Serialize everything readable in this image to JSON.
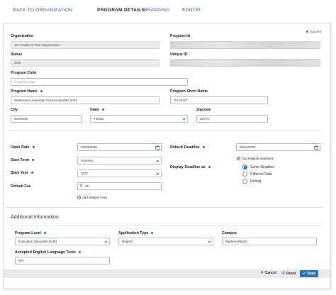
{
  "nav": {
    "back": "BACK TO ORGANIZATION",
    "program_details": "PROGRAM DETAILS",
    "branding": "BRANDING",
    "editor": "EDITOR"
  },
  "required_note": "required",
  "fields": {
    "organization": {
      "label": "Organization",
      "value": "zzz GradCAS Test Organization"
    },
    "program_id": {
      "label": "Program Id",
      "value": ""
    },
    "status": {
      "label": "Status",
      "value": "draft"
    },
    "unique_id": {
      "label": "Unique ID",
      "value": ""
    },
    "program_code": {
      "label": "Program Code",
      "placeholder": "Program Code"
    },
    "program_name": {
      "label": "Program Name",
      "value": "Watertown University General Studies 2027"
    },
    "program_short_name": {
      "label": "Program Short Name",
      "value": "GS SU27"
    },
    "city": {
      "label": "City",
      "value": "Seminole"
    },
    "state": {
      "label": "State",
      "value": "Florida"
    },
    "zipcode": {
      "label": "Zipcode",
      "value": "33772"
    },
    "open_date": {
      "label": "Open Date",
      "value": "02/06/2026"
    },
    "default_deadline": {
      "label": "Default Deadline",
      "value": "05/31/2027"
    },
    "start_term": {
      "label": "Start Term",
      "value": "Summer"
    },
    "start_year": {
      "label": "Start Year",
      "value": "2027"
    },
    "default_fee": {
      "label": "Default Fee",
      "currency": "$",
      "value": "25"
    },
    "display_deadline_as": {
      "label": "Display Deadline as"
    }
  },
  "links": {
    "add_multiple_deadlines": "Add Multiple Deadlines",
    "add_multiple_fees": "Add Multiple Fees"
  },
  "deadline_options": [
    {
      "label": "Same Deadline",
      "selected": true
    },
    {
      "label": "Different Date",
      "selected": false
    },
    {
      "label": "Rolling",
      "selected": false
    }
  ],
  "additional": {
    "title": "Additional Information",
    "program_level": {
      "label": "Program Level",
      "value": "Education Specialist (EdS)"
    },
    "application_type": {
      "label": "Application Type",
      "value": "Degree"
    },
    "campus": {
      "label": "Campus",
      "value": "Madeira Beach"
    },
    "accepted_tests": {
      "label": "Accepted English Language Tests",
      "value": "N/A"
    }
  },
  "footer": {
    "cancel": "Cancel",
    "reset": "Reset",
    "save": "Save"
  },
  "colors": {
    "accent": "#2f73b9",
    "link": "#3a5ea8",
    "readonly_bg": "#e9eaec"
  }
}
